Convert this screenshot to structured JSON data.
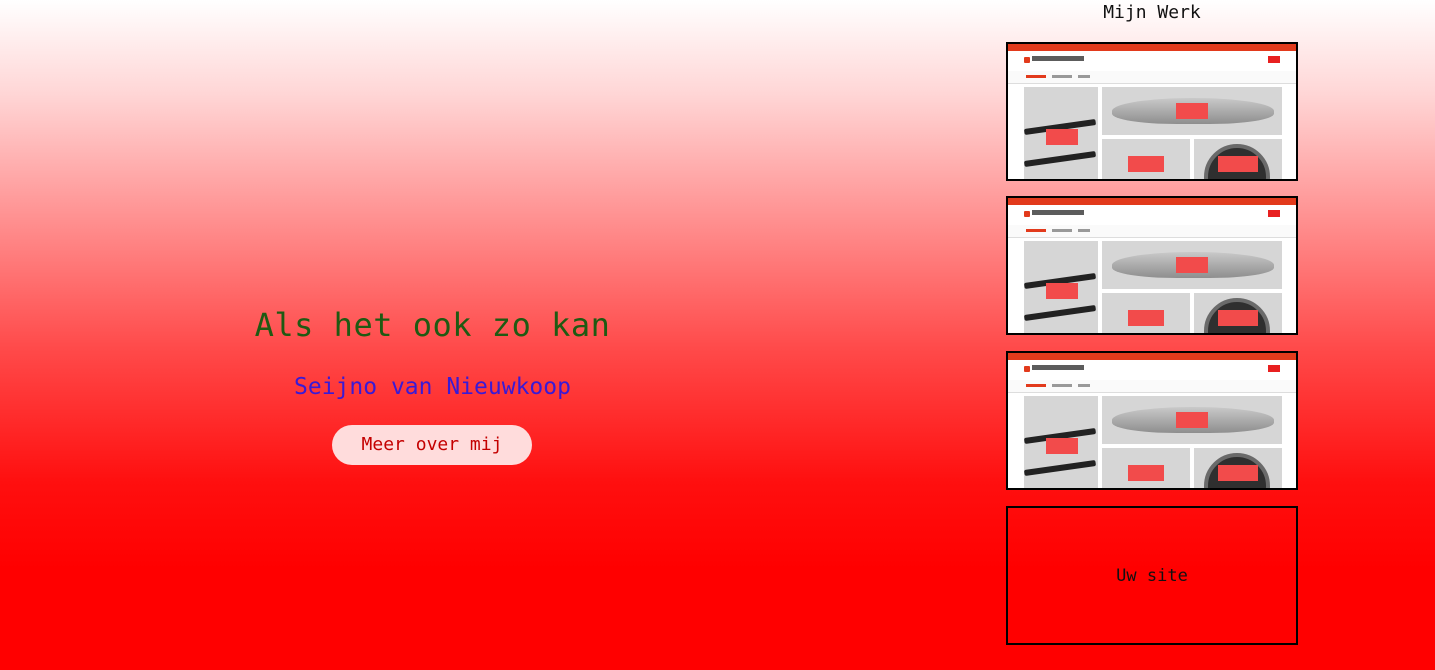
{
  "hero": {
    "title": "Als het ook zo kan",
    "name": "Seijno van Nieuwkoop",
    "button_label": "Meer over mij"
  },
  "work": {
    "title": "Mijn Werk",
    "projects": [
      {
        "name": "ERIOPUITVERHUUR screenshot"
      },
      {
        "name": "ERIOPUITVERHUUR screenshot"
      },
      {
        "name": "ERIOPUITVERHUUR screenshot"
      }
    ],
    "placeholder_label": "Uw site"
  },
  "colors": {
    "title": "#1f5a12",
    "name": "#3a1ad6",
    "accent": "#ff0000",
    "button_bg": "#ffdcdc",
    "button_text": "#c40000"
  }
}
